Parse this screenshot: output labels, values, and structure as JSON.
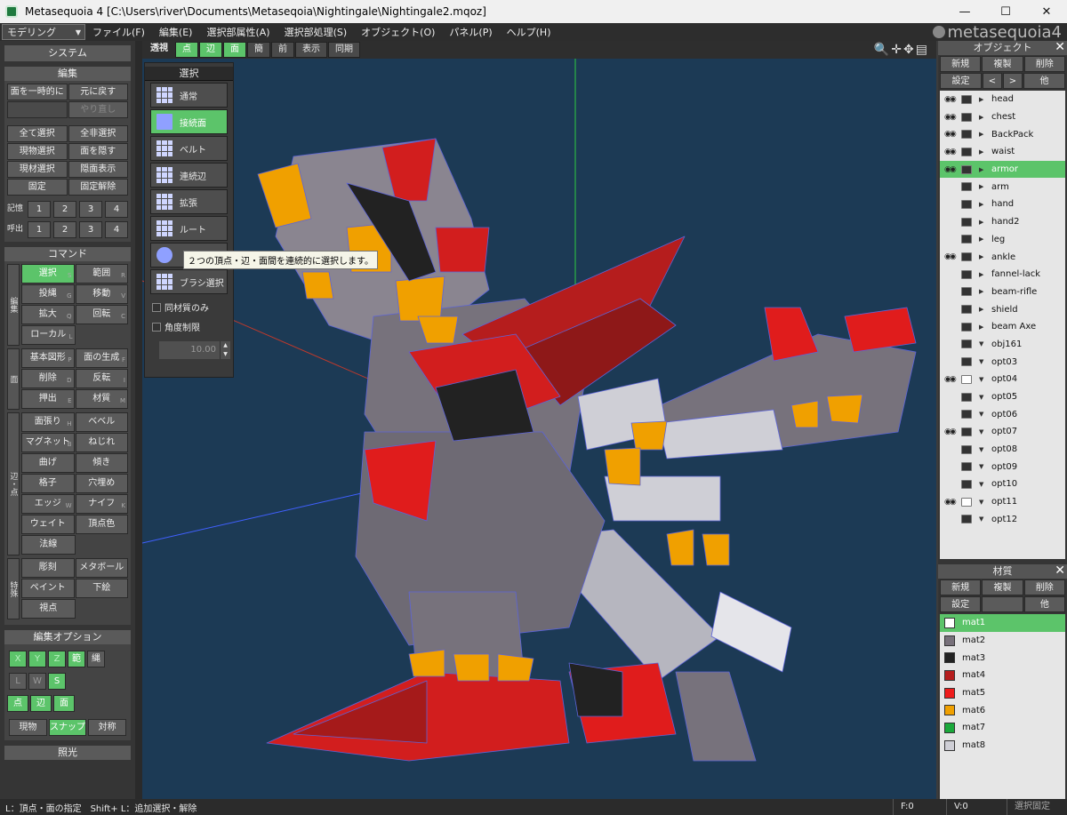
{
  "window": {
    "title": "Metasequoia 4 [C:\\Users\\river\\Documents\\Metaseqoia\\Nightingale\\Nightingale2.mqoz]",
    "controls": [
      "—",
      "☐",
      "✕"
    ]
  },
  "menubar": {
    "mode": "モデリング",
    "items": [
      "ファイル(F)",
      "編集(E)",
      "選択部属性(A)",
      "選択部処理(S)",
      "オブジェクト(O)",
      "パネル(P)",
      "ヘルプ(H)"
    ],
    "logo": "metasequoia4"
  },
  "left": {
    "system": "システム",
    "edit": {
      "title": "編集",
      "rows": [
        [
          "面を一時的に隠す",
          "元に戻す"
        ],
        [
          "",
          "やり直し"
        ],
        [
          "全て選択",
          "全非選択"
        ],
        [
          "現物選択",
          "面を隠す"
        ],
        [
          "現材選択",
          "隠面表示"
        ],
        [
          "固定",
          "固定解除"
        ]
      ],
      "memory_label": "記憶",
      "recall_label": "呼出",
      "nums": [
        "1",
        "2",
        "3",
        "4"
      ]
    },
    "command": {
      "title": "コマンド",
      "groups": [
        {
          "label": "編集",
          "rows": [
            [
              {
                "t": "選択",
                "s": "S",
                "on": true
              },
              {
                "t": "範囲",
                "s": "R"
              }
            ],
            [
              {
                "t": "投縄",
                "s": "G"
              },
              {
                "t": "移動",
                "s": "V"
              }
            ],
            [
              {
                "t": "拡大",
                "s": "Q"
              },
              {
                "t": "回転",
                "s": "C"
              }
            ],
            [
              {
                "t": "ローカル",
                "s": "L"
              }
            ]
          ]
        },
        {
          "label": "面",
          "rows": [
            [
              {
                "t": "基本図形",
                "s": "P"
              },
              {
                "t": "面の生成",
                "s": "F"
              }
            ],
            [
              {
                "t": "削除",
                "s": "D"
              },
              {
                "t": "反転",
                "s": "I"
              }
            ],
            [
              {
                "t": "押出",
                "s": "E"
              },
              {
                "t": "材質",
                "s": "M"
              }
            ]
          ]
        },
        {
          "label": "辺・点",
          "rows": [
            [
              {
                "t": "面張り",
                "s": "H"
              },
              {
                "t": "ベベル",
                "s": ""
              }
            ],
            [
              {
                "t": "マグネット",
                "s": "B"
              },
              {
                "t": "ねじれ",
                "s": ""
              }
            ],
            [
              {
                "t": "曲げ",
                "s": ""
              },
              {
                "t": "傾き",
                "s": ""
              }
            ],
            [
              {
                "t": "格子",
                "s": ""
              },
              {
                "t": "穴埋め",
                "s": ""
              }
            ],
            [
              {
                "t": "エッジ",
                "s": "W"
              },
              {
                "t": "ナイフ",
                "s": "K"
              }
            ],
            [
              {
                "t": "ウェイト",
                "s": ""
              },
              {
                "t": "頂点色",
                "s": ""
              }
            ],
            [
              {
                "t": "法線",
                "s": ""
              }
            ]
          ]
        },
        {
          "label": "特殊",
          "rows": [
            [
              {
                "t": "彫刻",
                "s": ""
              },
              {
                "t": "メタボール",
                "s": ""
              }
            ],
            [
              {
                "t": "ペイント",
                "s": ""
              },
              {
                "t": "下絵",
                "s": ""
              }
            ],
            [
              {
                "t": "視点",
                "s": ""
              }
            ]
          ]
        }
      ]
    },
    "editopt": {
      "title": "編集オプション",
      "axes": [
        "X",
        "Y",
        "Z"
      ],
      "range": "範",
      "line": "縄",
      "lws": [
        "L",
        "W",
        "S"
      ],
      "elem": [
        "点",
        "辺",
        "面"
      ],
      "bottom": [
        "現物",
        "スナップ",
        "対称"
      ]
    },
    "light": "照光"
  },
  "viewtoolbar": {
    "items": [
      {
        "t": "透視",
        "on": false
      },
      {
        "t": "点",
        "on": true
      },
      {
        "t": "辺",
        "on": true
      },
      {
        "t": "面",
        "on": true
      },
      {
        "t": "簡",
        "on": false
      },
      {
        "t": "前",
        "on": false
      },
      {
        "t": "表示",
        "on": false
      },
      {
        "t": "同期",
        "on": false
      }
    ]
  },
  "selpanel": {
    "title": "選択",
    "buttons": [
      {
        "t": "通常",
        "on": false
      },
      {
        "t": "接続面",
        "on": true
      },
      {
        "t": "ベルト",
        "on": false
      },
      {
        "t": "連続辺",
        "on": false
      },
      {
        "t": "拡張",
        "on": false
      },
      {
        "t": "ルート",
        "on": false
      },
      {
        "t": "",
        "on": false
      },
      {
        "t": "ブラシ選択",
        "on": false
      }
    ],
    "check1": "同材質のみ",
    "check2": "角度制限",
    "angle": "10.00",
    "tooltip": "２つの頂点・辺・面間を連続的に選択します。"
  },
  "objects": {
    "title": "オブジェクト",
    "buttons1": [
      "新規",
      "複製",
      "削除"
    ],
    "buttons2": [
      "設定",
      "<",
      ">",
      "他"
    ],
    "items": [
      {
        "name": "head",
        "eye": true,
        "lock": true,
        "tri": "▶"
      },
      {
        "name": "chest",
        "eye": true,
        "lock": true,
        "tri": "▶"
      },
      {
        "name": "BackPack",
        "eye": true,
        "lock": true,
        "tri": "▶"
      },
      {
        "name": "waist",
        "eye": true,
        "lock": true,
        "tri": "▶"
      },
      {
        "name": "armor",
        "eye": true,
        "lock": true,
        "tri": "▶",
        "on": true
      },
      {
        "name": "arm",
        "eye": false,
        "lock": true,
        "tri": "▶"
      },
      {
        "name": "hand",
        "eye": false,
        "lock": true,
        "tri": "▶"
      },
      {
        "name": "hand2",
        "eye": false,
        "lock": true,
        "tri": "▶"
      },
      {
        "name": "leg",
        "eye": false,
        "lock": true,
        "tri": "▶"
      },
      {
        "name": "ankle",
        "eye": true,
        "lock": true,
        "tri": "▶"
      },
      {
        "name": "fannel-lack",
        "eye": false,
        "lock": true,
        "tri": "▶"
      },
      {
        "name": "beam-rifle",
        "eye": false,
        "lock": true,
        "tri": "▶"
      },
      {
        "name": "shield",
        "eye": false,
        "lock": true,
        "tri": "▶"
      },
      {
        "name": "beam Axe",
        "eye": false,
        "lock": true,
        "tri": "▶"
      },
      {
        "name": "obj161",
        "eye": false,
        "lock": true,
        "tri": "▼"
      },
      {
        "name": "opt03",
        "eye": false,
        "lock": true,
        "tri": "▼"
      },
      {
        "name": "opt04",
        "eye": true,
        "lock": false,
        "tri": "▼"
      },
      {
        "name": "opt05",
        "eye": false,
        "lock": true,
        "tri": "▼"
      },
      {
        "name": "opt06",
        "eye": false,
        "lock": true,
        "tri": "▼"
      },
      {
        "name": "opt07",
        "eye": true,
        "lock": true,
        "tri": "▼"
      },
      {
        "name": "opt08",
        "eye": false,
        "lock": true,
        "tri": "▼"
      },
      {
        "name": "opt09",
        "eye": false,
        "lock": true,
        "tri": "▼"
      },
      {
        "name": "opt10",
        "eye": false,
        "lock": true,
        "tri": "▼"
      },
      {
        "name": "opt11",
        "eye": true,
        "lock": false,
        "tri": "▼"
      },
      {
        "name": "opt12",
        "eye": false,
        "lock": true,
        "tri": "▼"
      }
    ]
  },
  "materials": {
    "title": "材質",
    "buttons1": [
      "新規",
      "複製",
      "削除"
    ],
    "buttons2": [
      "設定",
      "",
      "他"
    ],
    "items": [
      {
        "name": "mat1",
        "color": "#ffffff",
        "on": true
      },
      {
        "name": "mat2",
        "color": "#77707a"
      },
      {
        "name": "mat3",
        "color": "#222222"
      },
      {
        "name": "mat4",
        "color": "#b51d1d"
      },
      {
        "name": "mat5",
        "color": "#ee1c1c"
      },
      {
        "name": "mat6",
        "color": "#f0a000"
      },
      {
        "name": "mat7",
        "color": "#1aa83a"
      },
      {
        "name": "mat8",
        "color": "#cfcfd6"
      }
    ]
  },
  "status": {
    "hint": "L：頂点・面の指定　Shift+ L：追加選択・解除",
    "f": "F:0",
    "v": "V:0",
    "fix": "選択固定"
  },
  "colors": {
    "accent": "#5cc46a",
    "viewport": "#1c3a55"
  }
}
